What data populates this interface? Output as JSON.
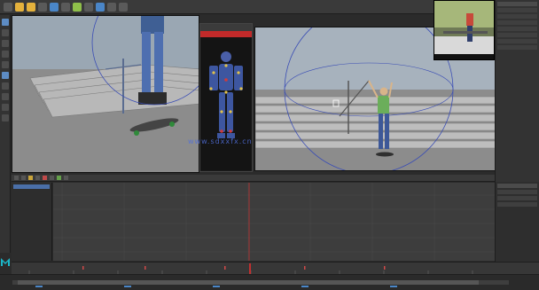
{
  "watermark": "www.sdxxfx.cn",
  "colors": {
    "accent_red": "#c22a2a",
    "accent_blue": "#4a86c8",
    "playhead": "#c03030"
  },
  "icons": [
    "maya-logo-icon",
    "select-tool-icon",
    "move-tool-icon",
    "rotate-tool-icon",
    "scale-tool-icon"
  ]
}
